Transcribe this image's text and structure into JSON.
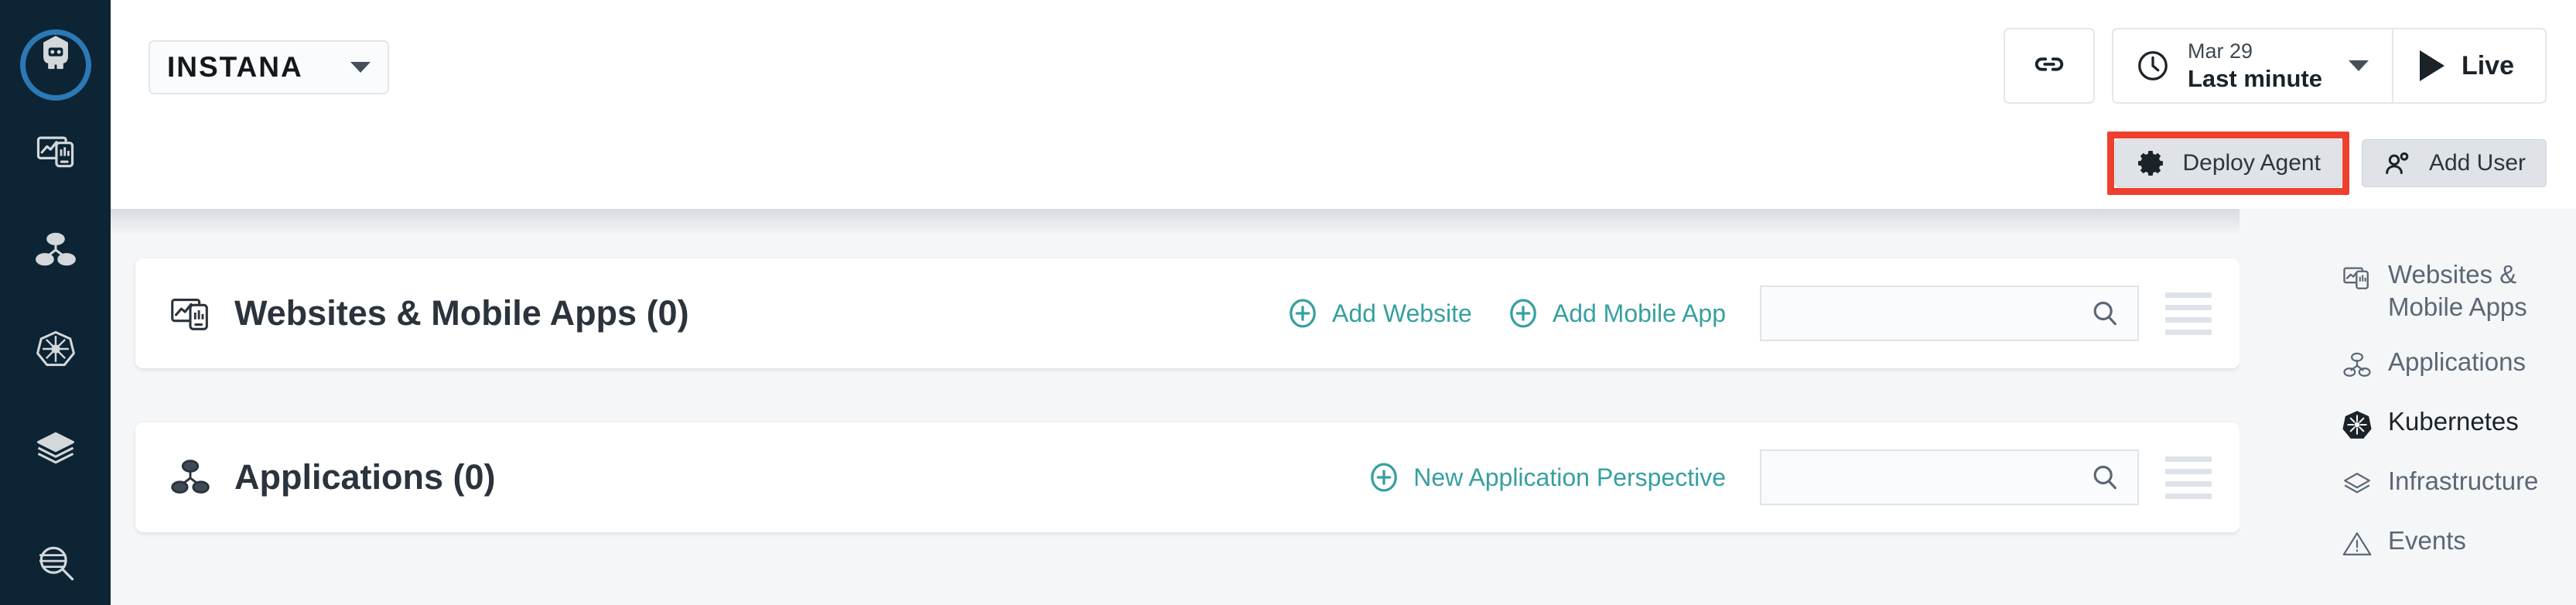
{
  "sidebar": {
    "items": [
      {
        "name": "robot-assistant",
        "icon": "robot-icon",
        "active": true
      },
      {
        "name": "websites-mobile-apps",
        "icon": "website-mobile-icon",
        "active": false
      },
      {
        "name": "applications",
        "icon": "applications-icon",
        "active": false
      },
      {
        "name": "kubernetes",
        "icon": "kubernetes-icon",
        "active": false
      },
      {
        "name": "infrastructure",
        "icon": "layers-icon",
        "active": false
      },
      {
        "name": "analyze",
        "icon": "analyze-search-icon",
        "active": false
      }
    ]
  },
  "header": {
    "tenant": "INSTANA",
    "link_button_icon": "link-icon",
    "time_picker": {
      "icon": "clock-icon",
      "date": "Mar 29",
      "range": "Last minute"
    },
    "live_button": {
      "icon": "play-icon",
      "label": "Live"
    },
    "actions": [
      {
        "label": "Deploy Agent",
        "icon": "gear-icon",
        "highlighted": true
      },
      {
        "label": "Add User",
        "icon": "add-user-icon",
        "highlighted": false
      }
    ],
    "highlight_color": "#ee402d"
  },
  "cards": [
    {
      "icon": "website-mobile-icon",
      "title": "Websites & Mobile Apps (0)",
      "links": [
        {
          "label": "Add Website",
          "icon": "plus-circle-icon"
        },
        {
          "label": "Add Mobile App",
          "icon": "plus-circle-icon"
        }
      ],
      "search": {
        "value": "",
        "placeholder": "",
        "icon": "search-icon"
      },
      "menu_icon": "hamburger-icon"
    },
    {
      "icon": "applications-icon",
      "title": "Applications (0)",
      "links": [
        {
          "label": "New Application Perspective",
          "icon": "plus-circle-icon"
        }
      ],
      "search": {
        "value": "",
        "placeholder": "",
        "icon": "search-icon"
      },
      "menu_icon": "hamburger-icon"
    }
  ],
  "right_nav": {
    "items": [
      {
        "label": "Websites & Mobile Apps",
        "icon": "website-mobile-icon",
        "emphasis": false
      },
      {
        "label": "Applications",
        "icon": "applications-icon",
        "emphasis": false
      },
      {
        "label": "Kubernetes",
        "icon": "kubernetes-icon",
        "emphasis": true
      },
      {
        "label": "Infrastructure",
        "icon": "layers-icon",
        "emphasis": false
      },
      {
        "label": "Events",
        "icon": "warning-triangle-icon",
        "emphasis": false
      }
    ]
  },
  "colors": {
    "rail_bg": "#0c2434",
    "accent_teal": "#36a0a0",
    "active_ring": "#2b79b5",
    "content_bg": "#f4f6f8"
  }
}
